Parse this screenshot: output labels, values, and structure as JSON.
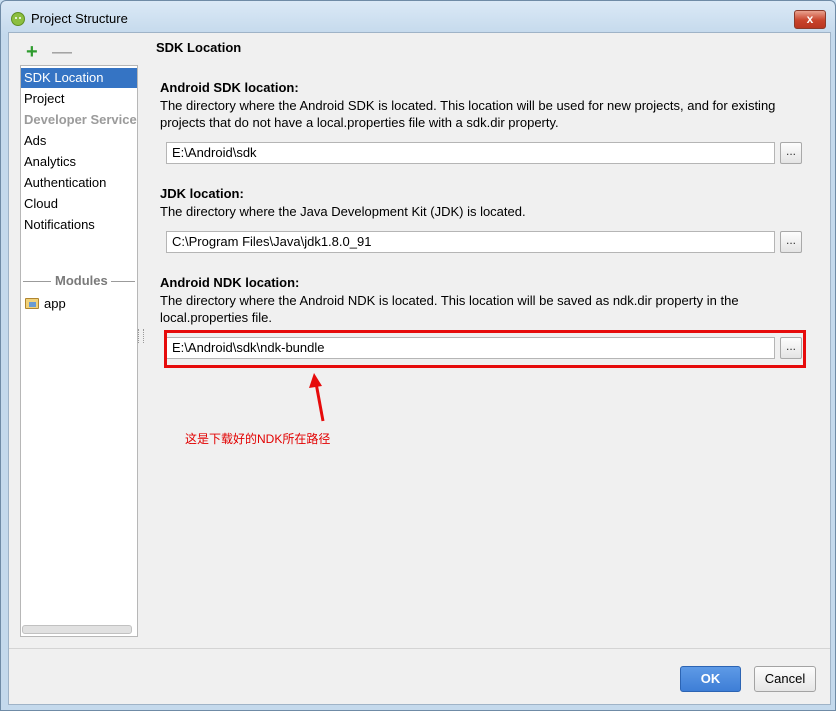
{
  "window": {
    "title": "Project Structure",
    "close_glyph": "x"
  },
  "toolbar": {
    "add_glyph": "+",
    "remove_glyph": "—"
  },
  "sidebar": {
    "items": [
      {
        "label": "SDK Location",
        "selected": true
      },
      {
        "label": "Project"
      }
    ],
    "group_label": "Developer Services",
    "service_items": [
      {
        "label": "Ads"
      },
      {
        "label": "Analytics"
      },
      {
        "label": "Authentication"
      },
      {
        "label": "Cloud"
      },
      {
        "label": "Notifications"
      }
    ],
    "modules_label": "Modules",
    "modules": [
      {
        "label": "app",
        "icon": "module-folder-icon"
      }
    ]
  },
  "main": {
    "section_title": "SDK Location",
    "android_sdk": {
      "title": "Android SDK location:",
      "description": "The directory where the Android SDK is located. This location will be used for new projects, and for existing projects that do not have a local.properties file with a sdk.dir property.",
      "path": "E:\\Android\\sdk"
    },
    "jdk": {
      "title": "JDK location:",
      "description": "The directory where the Java Development Kit (JDK) is located.",
      "path": "C:\\Program Files\\Java\\jdk1.8.0_91"
    },
    "android_ndk": {
      "title": "Android NDK location:",
      "description": "The directory where the Android NDK is located. This location will be saved as ndk.dir property in the local.properties file.",
      "path": "E:\\Android\\sdk\\ndk-bundle"
    },
    "browse_label": "..."
  },
  "annotation": {
    "text": "这是下载好的NDK所在路径",
    "color": "#e60b0b"
  },
  "footer": {
    "ok_label": "OK",
    "cancel_label": "Cancel"
  },
  "colors": {
    "selection": "#3574c4",
    "ok_button": "#4a88dc",
    "highlight": "#e60b0b"
  }
}
